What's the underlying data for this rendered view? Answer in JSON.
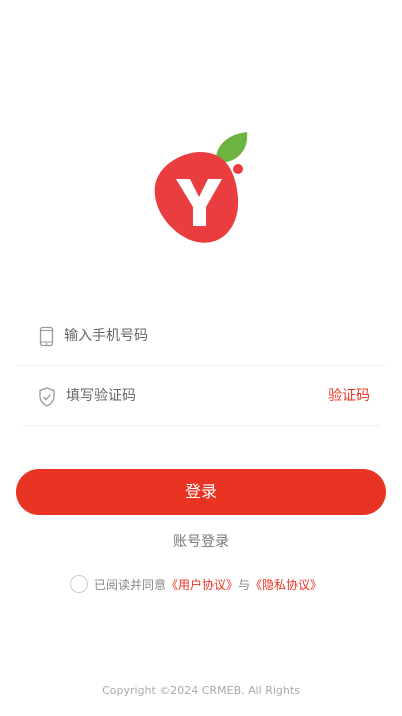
{
  "login": {
    "phone_placeholder": "输入手机号码",
    "code_placeholder": "填写验证码",
    "get_code_label": "验证码",
    "login_button_label": "登录",
    "account_login_label": "账号登录"
  },
  "agreement": {
    "prefix_text": "已阅读并同意",
    "user_agreement": "《用户协议》",
    "and_text": "与",
    "privacy_policy": "《隐私协议》",
    "checked": false
  },
  "footer": {
    "copyright": "Copyright ©2024 CRMEB. All Rights"
  },
  "theme": {
    "accent": "#e93323",
    "logo_leaf": "#6db33f"
  },
  "icons": {
    "logo": "brand-logo-icon",
    "phone": "mobile-phone-icon",
    "code": "shield-check-icon"
  }
}
